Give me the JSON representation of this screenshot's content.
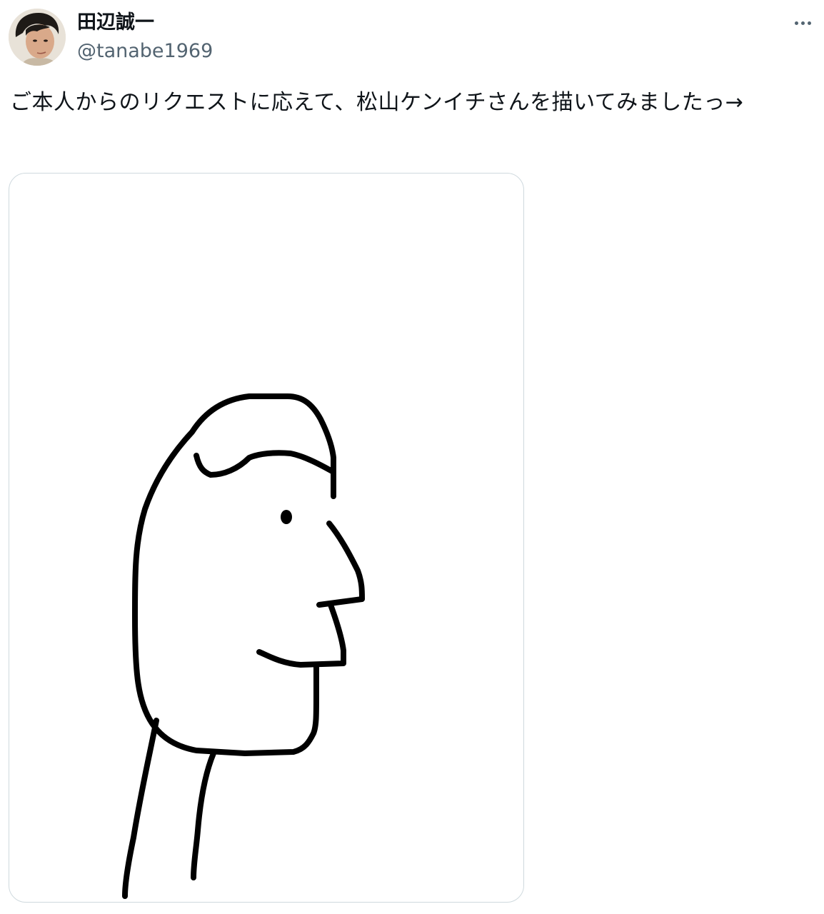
{
  "author": {
    "display_name": "田辺誠一",
    "handle": "@tanabe1969",
    "avatar_icon": "profile-photo"
  },
  "menu": {
    "icon": "more-options-icon"
  },
  "tweet": {
    "text": "ご本人からのリクエストに応えて、松山ケンイチさんを描いてみましたっ→"
  },
  "media": {
    "kind": "line-drawing-profile-face",
    "stroke_color": "#000000",
    "background_color": "#ffffff"
  },
  "colors": {
    "text_primary": "#0f1419",
    "text_secondary": "#536471",
    "border": "#cfd9de"
  }
}
